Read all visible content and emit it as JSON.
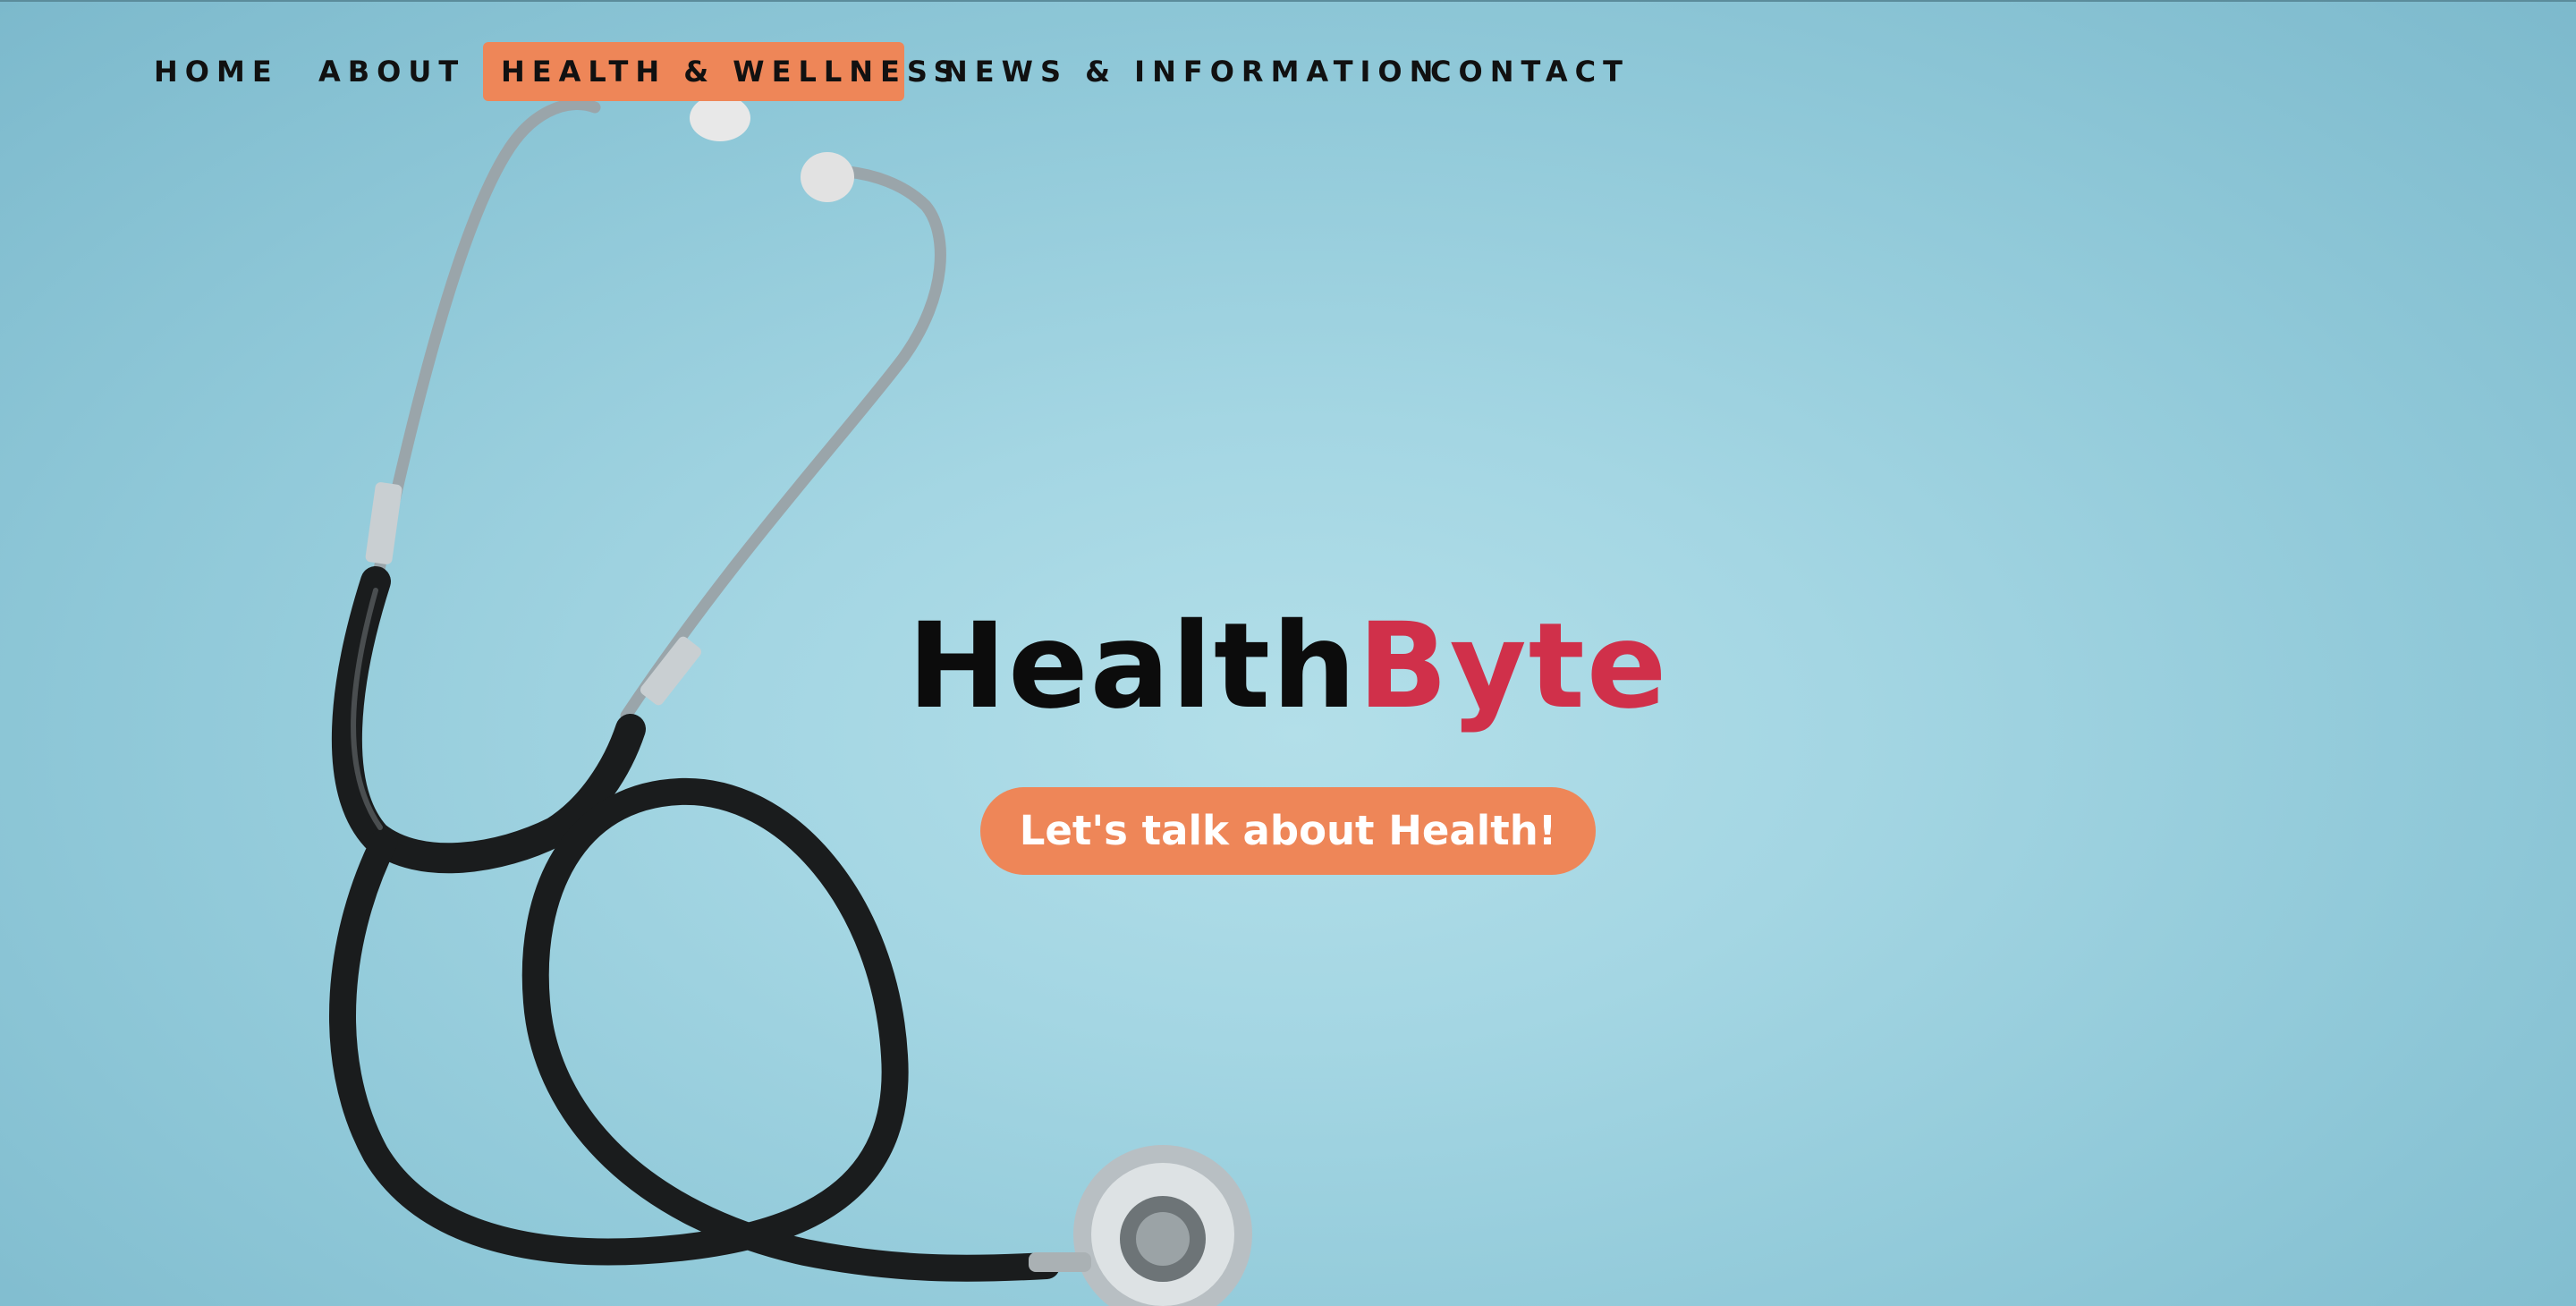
{
  "nav": {
    "items": [
      {
        "label": "HOME"
      },
      {
        "label": "ABOUT"
      },
      {
        "label": "HEALTH & WELLNESS",
        "active": true
      },
      {
        "label": "NEWS & INFORMATION"
      },
      {
        "label": "CONTACT"
      }
    ]
  },
  "hero": {
    "brand_part1": "Health",
    "brand_part2": "Byte",
    "cta_label": "Let's talk about Health!",
    "background_image": "stethoscope-on-light-blue-background"
  },
  "colors": {
    "background": "#a4d6e3",
    "accent": "#ee8658",
    "brand_red": "#d0304a",
    "text_dark": "#111111"
  }
}
